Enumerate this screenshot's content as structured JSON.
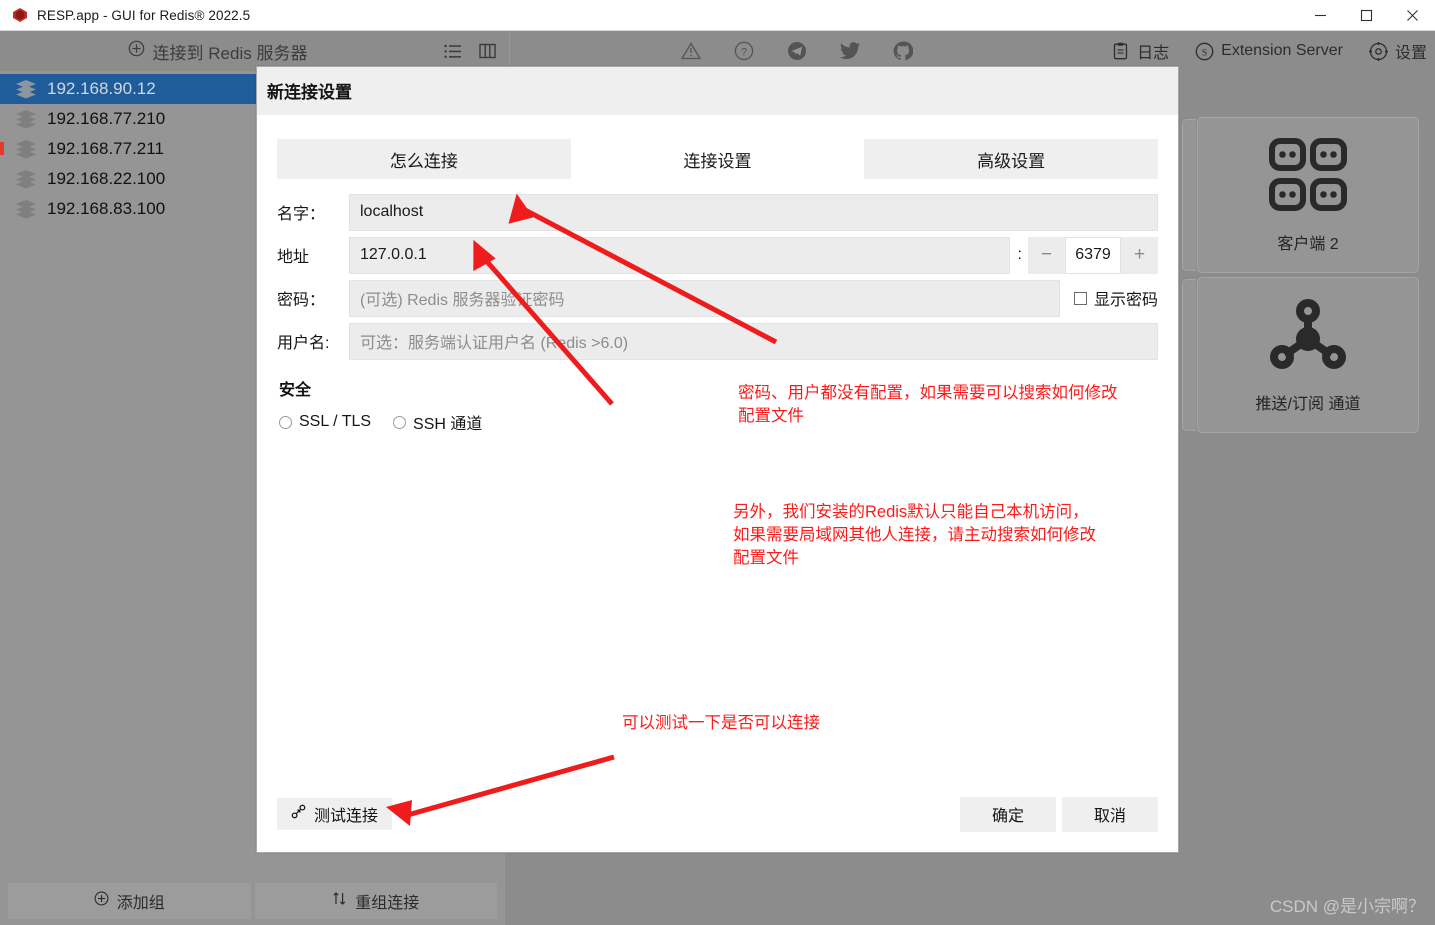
{
  "window": {
    "title": "RESP.app - GUI for Redis® 2022.5",
    "app_icon": "redis-logo-icon",
    "controls": {
      "minimize": "minimize-icon",
      "maximize": "maximize-icon",
      "close": "close-icon"
    }
  },
  "toolbar": {
    "connect_label": "连接到 Redis 服务器",
    "connect_icon": "plus-circle-icon",
    "list_icon": "list-icon",
    "split_icon": "split-pane-icon",
    "mid_icons": [
      "warning-triangle-icon",
      "question-circle-icon",
      "telegram-icon",
      "twitter-icon",
      "github-icon"
    ],
    "right_items": [
      {
        "icon": "clipboard-icon",
        "label": "日志"
      },
      {
        "icon": "extension-icon",
        "label": "Extension Server"
      },
      {
        "icon": "gear-icon",
        "label": "设置"
      }
    ]
  },
  "sidebar": {
    "connections": [
      {
        "label": "192.168.90.12",
        "icon": "stack-icon",
        "active": true
      },
      {
        "label": "192.168.77.210",
        "icon": "stack-icon",
        "active": false
      },
      {
        "label": "192.168.77.211",
        "icon": "stack-icon",
        "active": false
      },
      {
        "label": "192.168.22.100",
        "icon": "stack-icon",
        "active": false
      },
      {
        "label": "192.168.83.100",
        "icon": "stack-icon",
        "active": false
      }
    ],
    "add_group": {
      "icon": "plus-circle-icon",
      "label": "添加组"
    },
    "regroup": {
      "icon": "sort-updown-icon",
      "label": "重组连接"
    }
  },
  "cards": [
    {
      "icon": "clients-grid-icon",
      "label": "客户端 2"
    },
    {
      "icon": "pubsub-node-icon",
      "label": "推送/订阅 通道"
    }
  ],
  "dialog": {
    "title": "新连接设置",
    "tabs": [
      {
        "label": "怎么连接",
        "active": false
      },
      {
        "label": "连接设置",
        "active": true
      },
      {
        "label": "高级设置",
        "active": false
      }
    ],
    "fields": {
      "name": {
        "label": "名字：",
        "value": "localhost",
        "placeholder": ""
      },
      "address": {
        "label": "地址",
        "value": "127.0.0.1",
        "placeholder": ""
      },
      "port": {
        "separator": ":",
        "minus": "−",
        "value": "6379",
        "plus": "+"
      },
      "password": {
        "label": "密码：",
        "value": "",
        "placeholder": "(可选) Redis 服务器验证密码"
      },
      "show_password": {
        "label": "显示密码",
        "checked": false
      },
      "username": {
        "label": "用户名:",
        "value": "",
        "placeholder": "可选：服务端认证用户名 (Redis >6.0)"
      }
    },
    "security": {
      "title": "安全",
      "options": [
        {
          "label": "SSL / TLS",
          "selected": false
        },
        {
          "label": "SSH 通道",
          "selected": false
        }
      ]
    },
    "footer": {
      "test_button": {
        "icon": "plug-icon",
        "label": "测试连接"
      },
      "ok_button": "确定",
      "cancel_button": "取消"
    }
  },
  "annotations": [
    {
      "id": "note-credentials",
      "text": "密码、用户都没有配置，如果需要可以搜索如何修改\n配置文件"
    },
    {
      "id": "note-localonly",
      "text": "另外，我们安装的Redis默认只能自己本机访问，\n如果需要局域网其他人连接，请主动搜索如何修改\n配置文件"
    },
    {
      "id": "note-test",
      "text": "可以测试一下是否可以连接"
    }
  ],
  "watermark": "CSDN @是小宗啊？",
  "colors": {
    "annotation_red": "#fc1b1b",
    "selection_blue": "#1f5c99",
    "app_background": "#8c8c8c",
    "dialog_background": "#ffffff"
  }
}
